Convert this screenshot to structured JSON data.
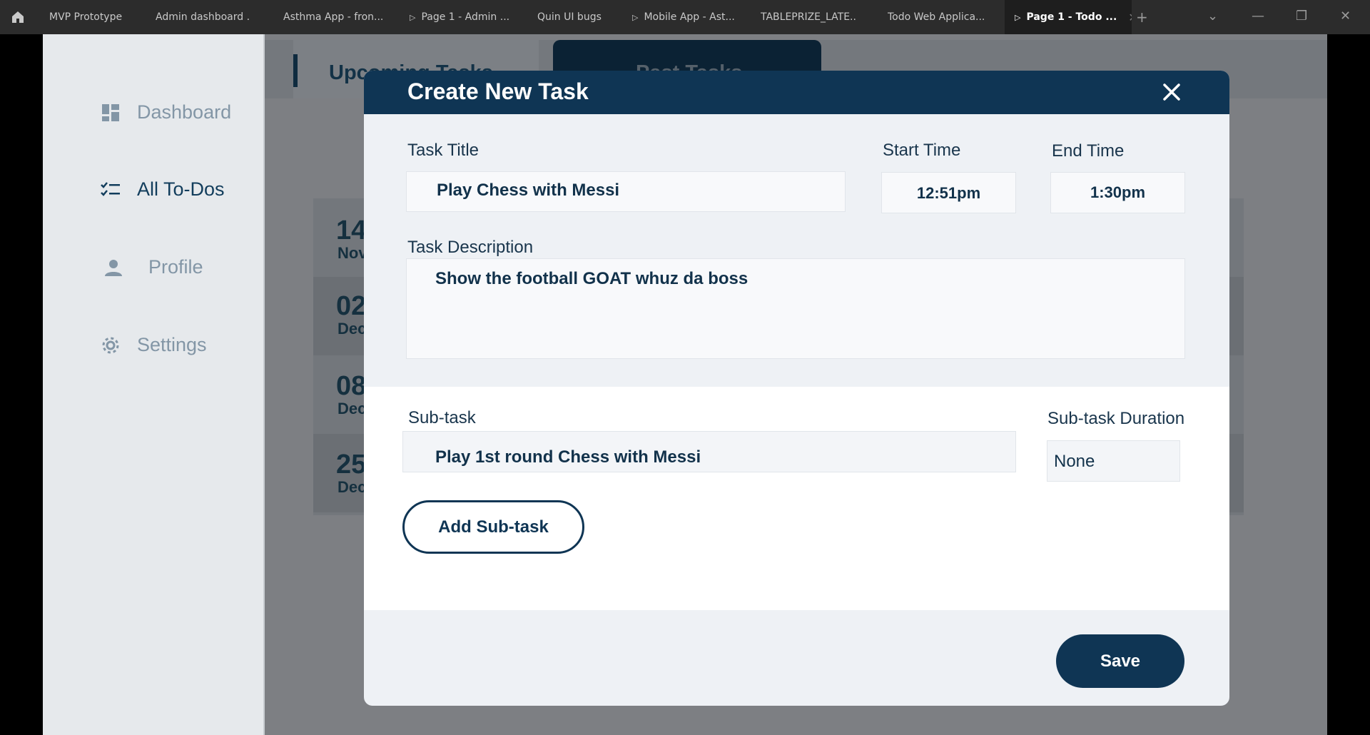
{
  "browser": {
    "tabs": [
      {
        "label": "MVP Prototype"
      },
      {
        "label": "Admin dashboard ..."
      },
      {
        "label": "Asthma App - fron..."
      },
      {
        "label": "Page 1 - Admin ..."
      },
      {
        "label": "Quin UI bugs"
      },
      {
        "label": "Mobile App - Ast..."
      },
      {
        "label": "TABLEPRIZE_LATE..."
      },
      {
        "label": "Todo Web Applica..."
      },
      {
        "label": "Page 1 - Todo ..."
      }
    ]
  },
  "sidebar": {
    "items": [
      {
        "label": "Dashboard",
        "icon": "dashboard-icon"
      },
      {
        "label": "All To-Dos",
        "icon": "checklist-icon",
        "active": true
      },
      {
        "label": "Profile",
        "icon": "person-icon"
      },
      {
        "label": "Settings",
        "icon": "gear-icon"
      }
    ]
  },
  "background": {
    "tabs": {
      "upcoming": "Upcoming Tasks",
      "past": "Past Tasks"
    },
    "rows": [
      {
        "day": "14",
        "month": "Nov"
      },
      {
        "day": "02",
        "month": "Dec"
      },
      {
        "day": "08",
        "month": "Dec"
      },
      {
        "day": "25",
        "month": "Dec"
      }
    ]
  },
  "modal": {
    "title": "Create New Task",
    "task_title_label": "Task Title",
    "task_title_value": "Play Chess with Messi",
    "start_time_label": "Start Time",
    "start_time_value": "12:51pm",
    "end_time_label": "End Time",
    "end_time_value": "1:30pm",
    "description_label": "Task Description",
    "description_value": "Show the football GOAT whuz da boss",
    "subtask_label": "Sub-task",
    "subtask_value": "Play 1st round Chess with Messi",
    "subtask_duration_label": "Sub-task Duration",
    "subtask_duration_value": "None",
    "add_subtask_label": "Add Sub-task",
    "save_label": "Save"
  },
  "colors": {
    "primary": "#0f3554",
    "sidebar_bg": "#e6e9ec",
    "overlay": "#7d7f83"
  }
}
